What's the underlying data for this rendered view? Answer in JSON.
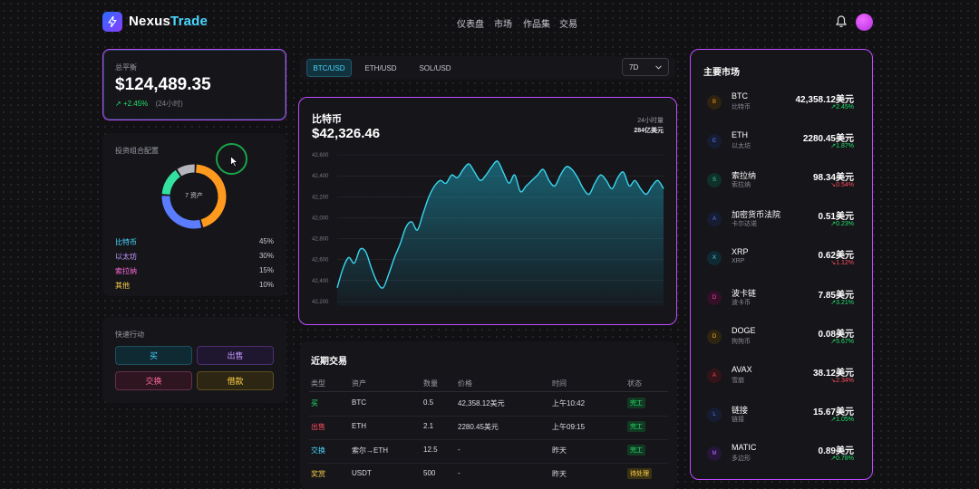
{
  "header": {
    "brand_name": "Nexus",
    "brand_accent": "Trade",
    "nav": [
      "仪表盘",
      "市场",
      "作品集",
      "交易"
    ],
    "icons": {
      "logo": "lightning-icon",
      "bell": "bell-icon",
      "avatar": "avatar"
    }
  },
  "balance": {
    "label": "总平衡",
    "amount": "$124,489.35",
    "change": "+2.45%",
    "change_arrow": "↗",
    "period": "(24小时)"
  },
  "allocation": {
    "title": "投资组合配置",
    "center_label": "7 资产",
    "items": [
      {
        "name": "比特币",
        "pct": "45%",
        "value": 45,
        "color": "#ff9a1f"
      },
      {
        "name": "以太坊",
        "pct": "30%",
        "value": 30,
        "color": "#5b7cff"
      },
      {
        "name": "索拉纳",
        "pct": "15%",
        "value": 15,
        "color": "#33e0a0"
      },
      {
        "name": "其他",
        "pct": "10%",
        "value": 10,
        "color": "#b5b5bd"
      }
    ],
    "label_colors": [
      "#4ad8ff",
      "#c59bff",
      "#ff6bd6",
      "#ffd24a"
    ]
  },
  "quick_actions": {
    "title": "快速行动",
    "buttons": [
      {
        "label": "买",
        "color": "#4ad8ff",
        "bg": "#0f2a33",
        "border": "#1f4f5e"
      },
      {
        "label": "出售",
        "color": "#c59bff",
        "bg": "#1f1630",
        "border": "#4a2e70"
      },
      {
        "label": "交换",
        "color": "#ff6b9a",
        "bg": "#2e1520",
        "border": "#66304a"
      },
      {
        "label": "借款",
        "color": "#ffd24a",
        "bg": "#2c2612",
        "border": "#5e5020"
      }
    ]
  },
  "tabs": {
    "items": [
      "BTC/USD",
      "ETH/USD",
      "SOL/USD"
    ],
    "active": 0,
    "period_select": "7D"
  },
  "price_chart": {
    "title": "比特币",
    "price": "$42,326.46",
    "volume_label": "24小时量",
    "volume_value": "284亿美元"
  },
  "chart_data": {
    "type": "area",
    "title": "比特币",
    "y_ticks": [
      "42,600",
      "42,400",
      "42,200",
      "42,000",
      "42,800",
      "42,600",
      "42,400",
      "42,200"
    ],
    "ylim": [
      0,
      100
    ],
    "grid": true,
    "values": [
      8,
      22,
      30,
      26,
      36,
      34,
      22,
      12,
      8,
      18,
      30,
      40,
      52,
      56,
      50,
      62,
      74,
      82,
      86,
      84,
      90,
      88,
      94,
      98,
      92,
      86,
      90,
      96,
      100,
      92,
      84,
      90,
      78,
      82,
      86,
      90,
      94,
      86,
      82,
      90,
      96,
      94,
      88,
      80,
      76,
      84,
      90,
      86,
      80,
      88,
      92,
      82,
      86,
      80,
      76,
      82,
      86,
      80
    ]
  },
  "trades": {
    "title": "近期交易",
    "headers": [
      "类型",
      "资产",
      "数量",
      "价格",
      "时间",
      "状态"
    ],
    "rows": [
      {
        "type": "买",
        "type_color": "#22e06b",
        "asset": "BTC",
        "qty": "0.5",
        "price": "42,358.12美元",
        "time": "上午10:42",
        "status": "完工",
        "status_color": "#22e06b",
        "status_bg": "#123a22"
      },
      {
        "type": "出售",
        "type_color": "#ff4d5e",
        "asset": "ETH",
        "qty": "2.1",
        "price": "2280.45美元",
        "time": "上午09:15",
        "status": "完工",
        "status_color": "#22e06b",
        "status_bg": "#123a22"
      },
      {
        "type": "交换",
        "type_color": "#4ad8ff",
        "asset": "索尔→ETH",
        "qty": "12.5",
        "price": "-",
        "time": "昨天",
        "status": "完工",
        "status_color": "#22e06b",
        "status_bg": "#123a22"
      },
      {
        "type": "奖赏",
        "type_color": "#ffd24a",
        "asset": "USDT",
        "qty": "500",
        "price": "-",
        "time": "昨天",
        "status": "待处理",
        "status_color": "#ffd24a",
        "status_bg": "#3a3212"
      }
    ]
  },
  "markets": {
    "title": "主要市场",
    "items": [
      {
        "symbol": "BTC",
        "sub": "比特币",
        "price": "42,358.12美元",
        "change": "↗2.45%",
        "up": true,
        "color": "#ff9a1f",
        "bg": "#2e2210",
        "glyph": "B"
      },
      {
        "symbol": "ETH",
        "sub": "以太坊",
        "price": "2280.45美元",
        "change": "↗1.87%",
        "up": true,
        "color": "#5b7cff",
        "bg": "#161d33",
        "glyph": "E"
      },
      {
        "symbol": "索拉纳",
        "sub": "索拉纳",
        "price": "98.34美元",
        "change": "↘0.54%",
        "up": false,
        "color": "#33e0a0",
        "bg": "#10302a",
        "glyph": "S"
      },
      {
        "symbol": "加密货币法院",
        "sub": "卡尔达诺",
        "price": "0.51美元",
        "change": "↗0.23%",
        "up": true,
        "color": "#5b7cff",
        "bg": "#161d33",
        "glyph": "A"
      },
      {
        "symbol": "XRP",
        "sub": "XRP",
        "price": "0.62美元",
        "change": "↘1.12%",
        "up": false,
        "color": "#4ad8ff",
        "bg": "#102a33",
        "glyph": "X"
      },
      {
        "symbol": "波卡链",
        "sub": "波卡币",
        "price": "7.85美元",
        "change": "↗3.21%",
        "up": true,
        "color": "#ff4db8",
        "bg": "#331028",
        "glyph": "D"
      },
      {
        "symbol": "DOGE",
        "sub": "狗狗币",
        "price": "0.08美元",
        "change": "↗5.67%",
        "up": true,
        "color": "#ffb63a",
        "bg": "#2e2410",
        "glyph": "D"
      },
      {
        "symbol": "AVAX",
        "sub": "雪崩",
        "price": "38.12美元",
        "change": "↘2.34%",
        "up": false,
        "color": "#ff4d5e",
        "bg": "#331418",
        "glyph": "A"
      },
      {
        "symbol": "链接",
        "sub": "链接",
        "price": "15.67美元",
        "change": "↗1.05%",
        "up": true,
        "color": "#5b7cff",
        "bg": "#161d33",
        "glyph": "L"
      },
      {
        "symbol": "MATIC",
        "sub": "多边形",
        "price": "0.89美元",
        "change": "↗0.78%",
        "up": true,
        "color": "#b36bff",
        "bg": "#26163a",
        "glyph": "M"
      }
    ]
  }
}
